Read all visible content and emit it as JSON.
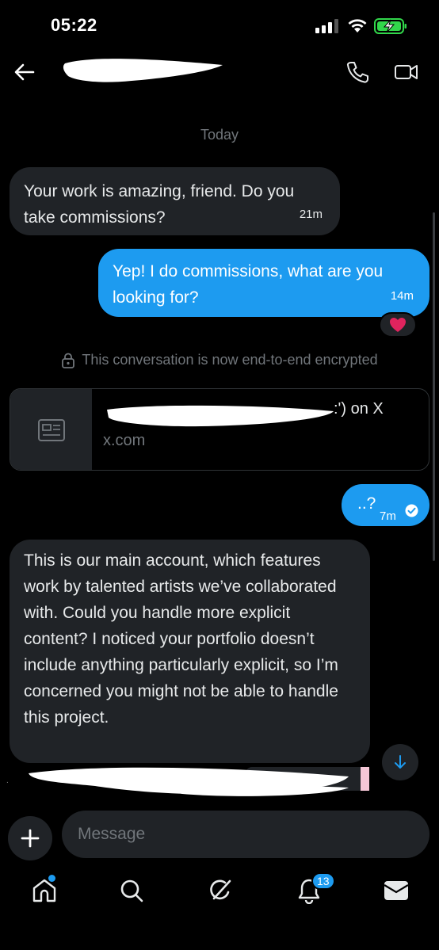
{
  "status_bar": {
    "time": "05:22"
  },
  "conversation": {
    "date_separator": "Today",
    "messages": [
      {
        "direction": "incoming",
        "text": "Your work is amazing, friend. Do you take commissions?",
        "time": "21m"
      },
      {
        "direction": "outgoing",
        "text": "Yep! I do commissions, what are you looking for?",
        "time": "14m",
        "reaction": "heart"
      },
      {
        "direction": "outgoing",
        "text": "..?",
        "time": "7m",
        "status": "read"
      },
      {
        "direction": "incoming",
        "text": "This is our main account, which features work by talented artists we’ve collaborated with. Could you handle more explicit content? I noticed your portfolio doesn’t include anything particularly explicit, so I’m concerned you might not be able to handle this project."
      }
    ],
    "encryption_notice": "This conversation is now end-to-end encrypted",
    "link_card": {
      "title_suffix": ":') on X",
      "domain": "x.com"
    }
  },
  "composer": {
    "placeholder": "Message"
  },
  "tabbar": {
    "notifications_badge": "13"
  },
  "colors": {
    "accent": "#1d9bf0",
    "incoming_bubble": "#202327",
    "background": "#000000",
    "muted": "#71767b",
    "heart": "#f91880"
  }
}
